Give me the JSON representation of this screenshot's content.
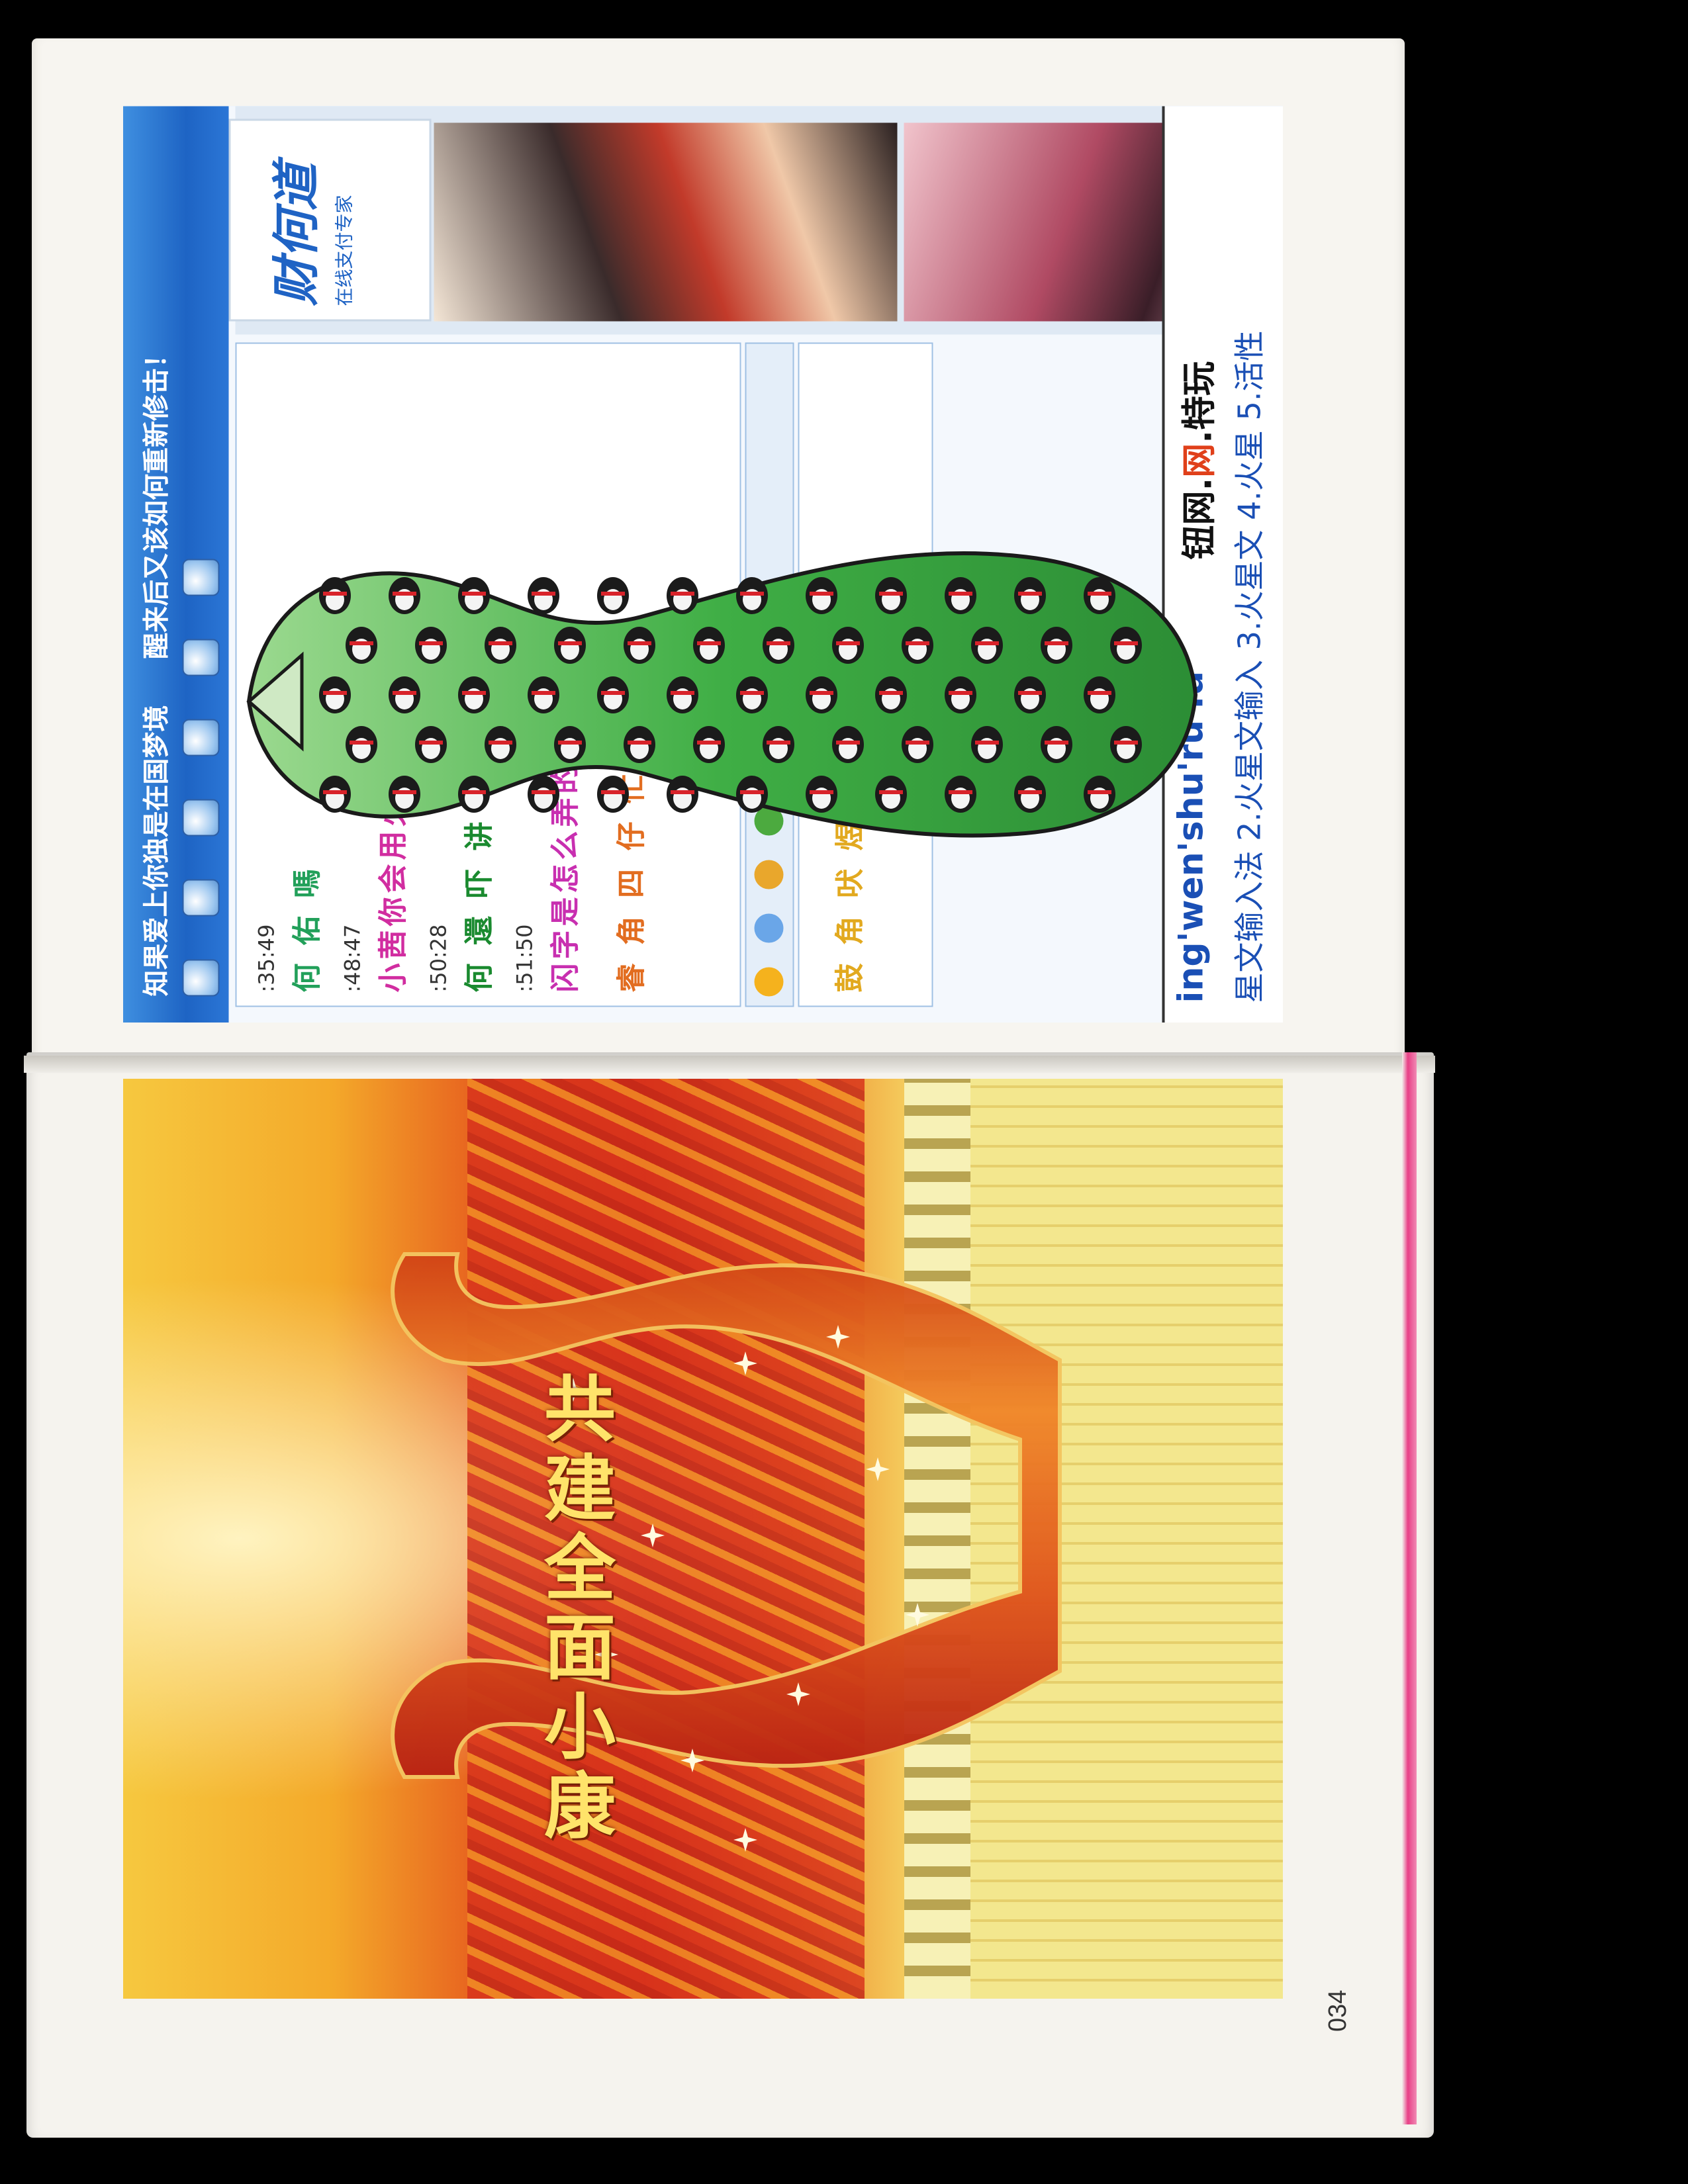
{
  "page_number": "034",
  "qq_window": {
    "topic": "知果爱上你独是在国梦境",
    "topic_right": "醒来后又该如何重新修击！",
    "chat": [
      {
        "time": ":35:49",
        "message": "何 佑 嗎"
      },
      {
        "time": ":48:47",
        "message": "小茜你会用火星文？"
      },
      {
        "time": ":50:28",
        "message": "何 還 吓 讲 吧"
      },
      {
        "time": ":51:50",
        "message": "闪字是怎么弄的啊"
      },
      {
        "time": "",
        "message": "睿 角 四 仔 忙"
      },
      {
        "time": "",
        "message": "鼓 角 吠 煜"
      }
    ],
    "emoticon_colors": [
      "#f5b21d",
      "#6aa6e8",
      "#e9a72c",
      "#4caa3f",
      "#f06ba8",
      "#e44f2a"
    ],
    "ad": {
      "logo": "财何道",
      "slogan": "在线支付专家"
    },
    "ime": {
      "pinyin": "ing'wen'shu'ru'fa",
      "candidates": "星文输入法   2.火星文输入   3.火星文   4.火星   5.活性",
      "hint": "钮网.",
      "hint_red": "网",
      "hint_tail": ".特玩"
    }
  },
  "poster": {
    "slogan": [
      "共",
      "建",
      "全",
      "面",
      "小",
      "康"
    ]
  },
  "colors": {
    "qq_blue": "#1e64c4",
    "qipao_green": "#4cba4a",
    "qipao_red": "#d8391b",
    "slogan_gold": "#ffe36a",
    "page_edge_pink": "#e83f86"
  }
}
